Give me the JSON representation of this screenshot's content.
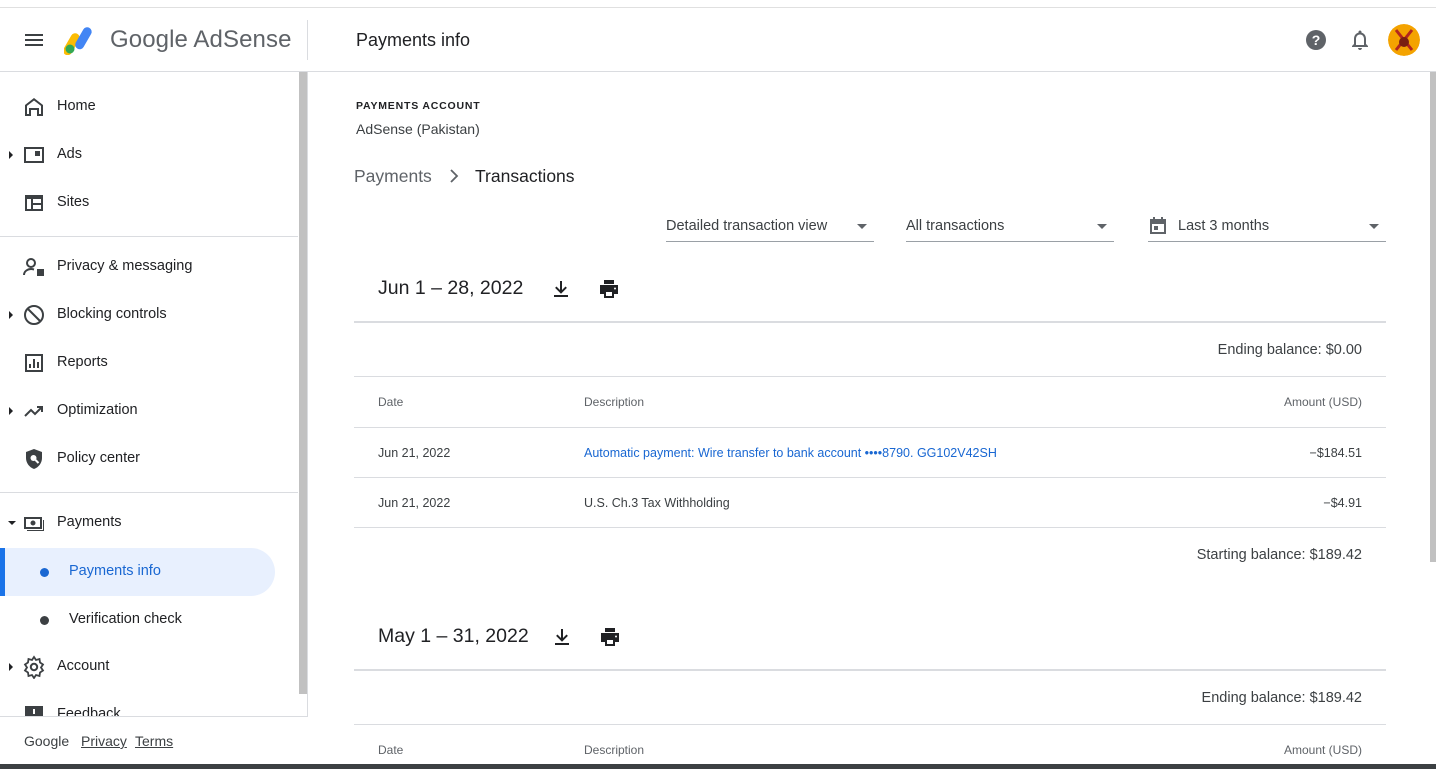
{
  "header": {
    "brand": "Google AdSense",
    "page_title": "Payments info"
  },
  "sidebar": {
    "items": [
      {
        "label": "Home",
        "icon": "home-icon"
      },
      {
        "label": "Ads",
        "icon": "ads-icon"
      },
      {
        "label": "Sites",
        "icon": "sites-icon"
      },
      {
        "label": "Privacy & messaging",
        "icon": "privacy-icon"
      },
      {
        "label": "Blocking controls",
        "icon": "block-icon"
      },
      {
        "label": "Reports",
        "icon": "reports-icon"
      },
      {
        "label": "Optimization",
        "icon": "optimization-icon"
      },
      {
        "label": "Policy center",
        "icon": "policy-icon"
      },
      {
        "label": "Payments",
        "icon": "payments-icon"
      },
      {
        "label": "Account",
        "icon": "gear-icon"
      },
      {
        "label": "Feedback",
        "icon": "feedback-icon"
      }
    ],
    "sub_items": [
      {
        "label": "Payments info",
        "active": true
      },
      {
        "label": "Verification check",
        "active": false
      }
    ],
    "footer": {
      "google": "Google",
      "privacy": "Privacy",
      "terms": "Terms"
    }
  },
  "main": {
    "account_label": "PAYMENTS ACCOUNT",
    "account_name": "AdSense (Pakistan)",
    "breadcrumb": [
      "Payments",
      "Transactions"
    ],
    "filters": {
      "view": "Detailed transaction view",
      "type": "All transactions",
      "range": "Last 3 months"
    },
    "columns": [
      "Date",
      "Description",
      "Amount (USD)"
    ],
    "periods": [
      {
        "title": "Jun 1 – 28, 2022",
        "ending_balance": "Ending balance: $0.00",
        "rows": [
          {
            "date": "Jun 21, 2022",
            "description": "Automatic payment: Wire transfer to bank account  ••••8790. GG102V42SH",
            "amount": "−$184.51",
            "link": true
          },
          {
            "date": "Jun 21, 2022",
            "description": "U.S. Ch.3 Tax Withholding",
            "amount": "−$4.91",
            "link": false
          }
        ],
        "starting_balance": "Starting balance: $189.42"
      },
      {
        "title": "May 1 – 31, 2022",
        "ending_balance": "Ending balance: $189.42",
        "rows": []
      }
    ]
  },
  "colors": {
    "accent": "#1a73e8",
    "active_bg": "#e8f0fe",
    "link": "#1967d2"
  }
}
